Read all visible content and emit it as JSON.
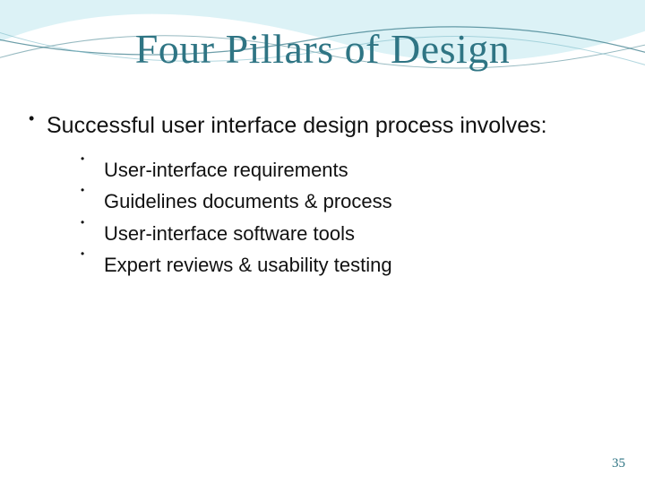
{
  "title": "Four Pillars of Design",
  "lead": "Successful user interface design process involves:",
  "sublist": [
    "User-interface requirements",
    "Guidelines documents & process",
    "User-interface software tools",
    "Expert reviews & usability testing"
  ],
  "page_number": "35"
}
